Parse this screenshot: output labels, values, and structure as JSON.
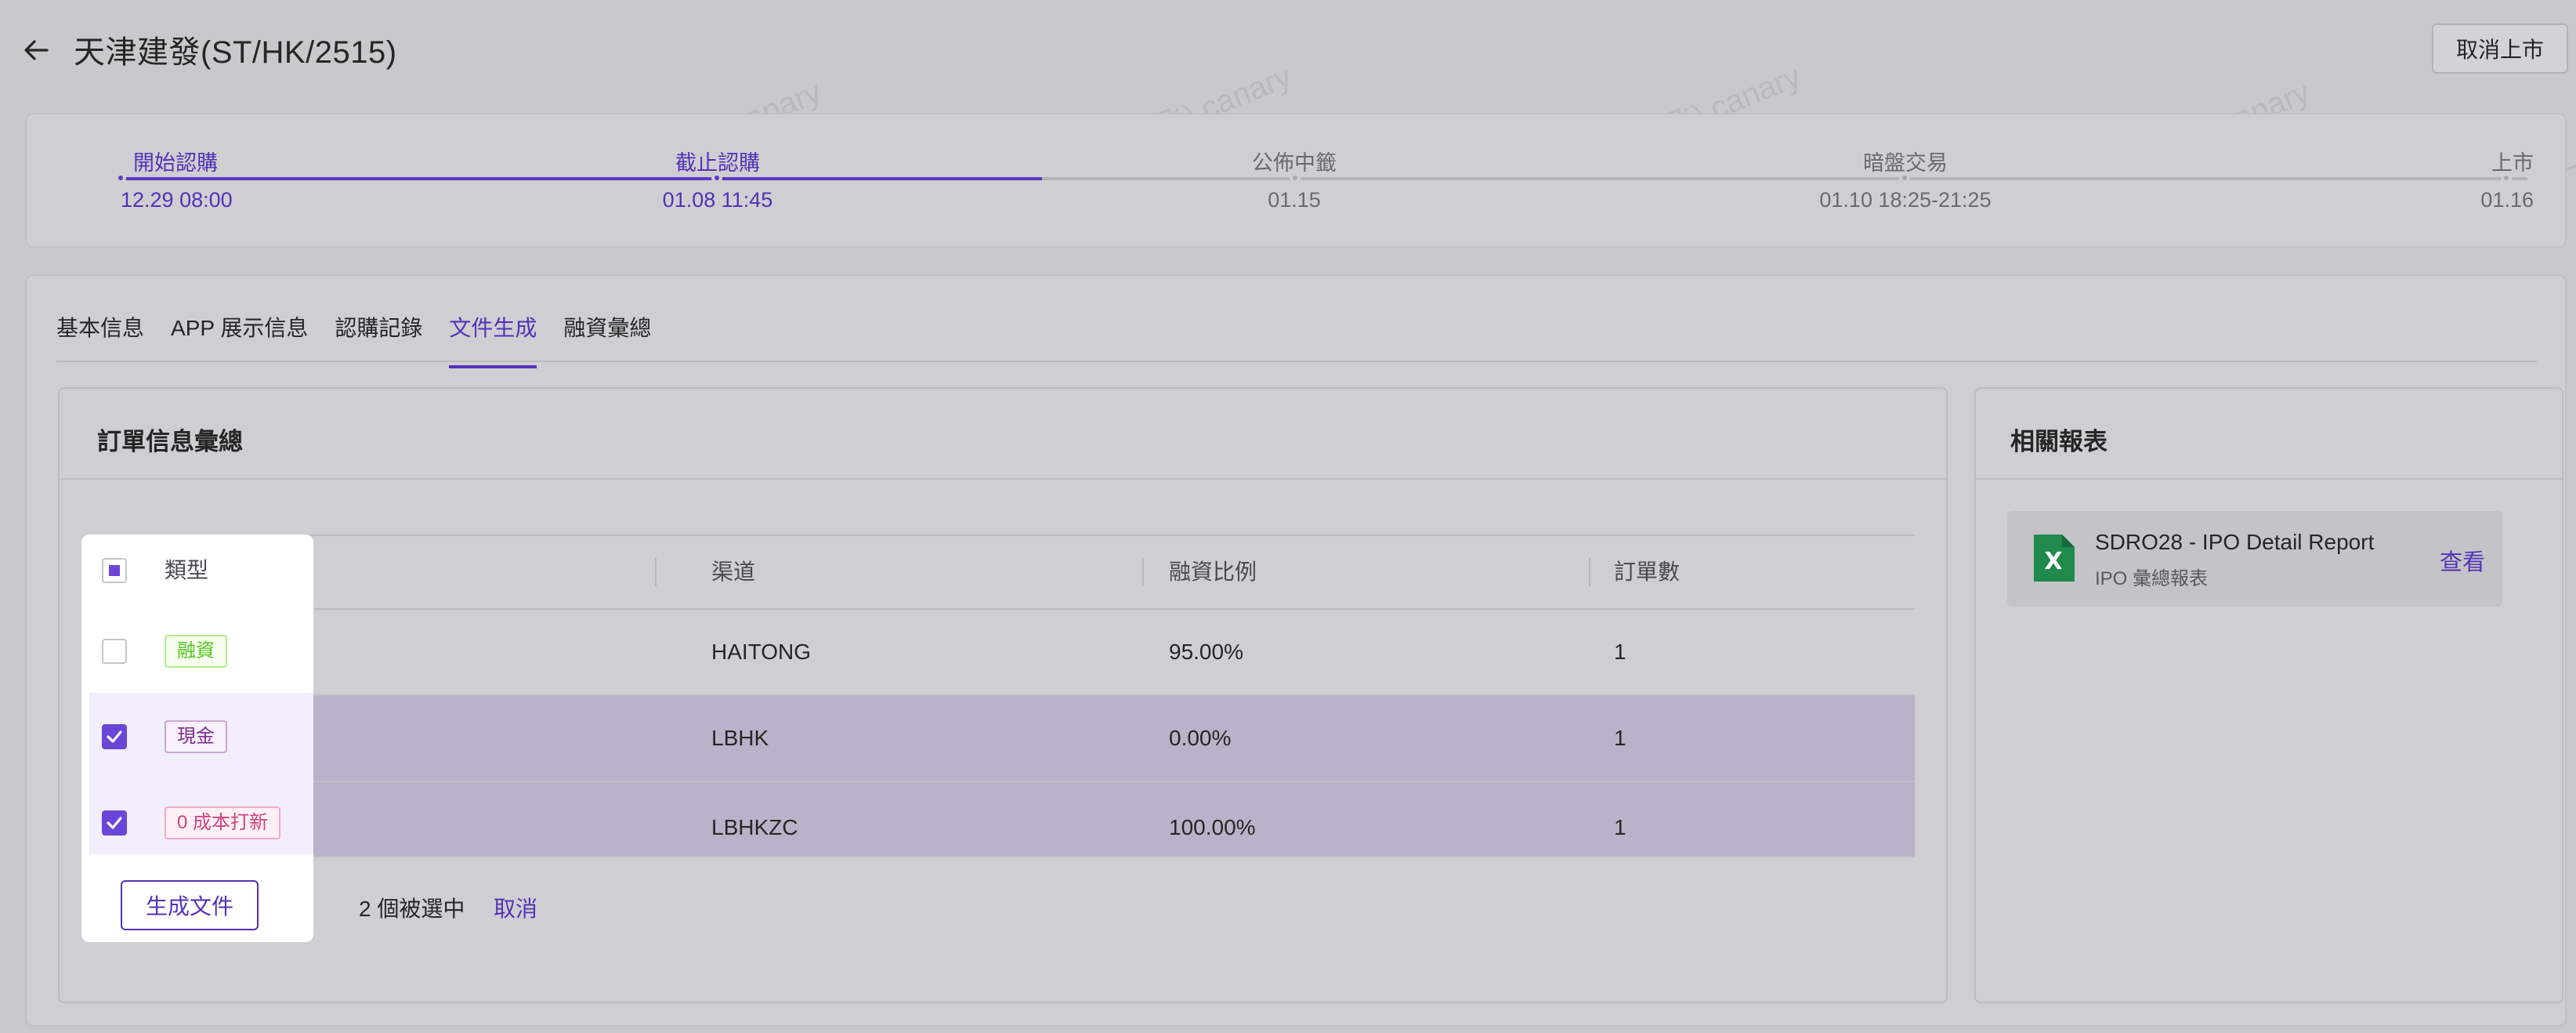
{
  "header": {
    "title": "天津建發(ST/HK/2515)",
    "unlist_label": "取消上市"
  },
  "timeline": [
    {
      "label": "開始認購",
      "time": "12.29 08:00",
      "status": "done"
    },
    {
      "label": "截止認購",
      "time": "01.08 11:45",
      "status": "done"
    },
    {
      "label": "公佈中籤",
      "time": "01.15",
      "status": "todo"
    },
    {
      "label": "暗盤交易",
      "time": "01.10 18:25-21:25",
      "status": "todo"
    },
    {
      "label": "上市",
      "time": "01.16",
      "status": "todo"
    }
  ],
  "tabs": [
    {
      "label": "基本信息",
      "active": false
    },
    {
      "label": "APP 展示信息",
      "active": false
    },
    {
      "label": "認購記錄",
      "active": false
    },
    {
      "label": "文件生成",
      "active": true
    },
    {
      "label": "融資彙總",
      "active": false
    }
  ],
  "orders": {
    "title": "訂單信息彙總",
    "columns": [
      "類型",
      "渠道",
      "融資比例",
      "訂單數"
    ],
    "rows": [
      {
        "type": "融資",
        "type_style": "finance",
        "channel": "HAITONG",
        "ratio": "95.00%",
        "count": "1",
        "checked": false
      },
      {
        "type": "現金",
        "type_style": "cash",
        "channel": "LBHK",
        "ratio": "0.00%",
        "count": "1",
        "checked": true
      },
      {
        "type": "0 成本打新",
        "type_style": "zero",
        "channel": "LBHKZC",
        "ratio": "100.00%",
        "count": "1",
        "checked": true
      }
    ],
    "generate_label": "生成文件",
    "selected_text": "2 個被選中",
    "cancel_label": "取消"
  },
  "reports": {
    "title": "相關報表",
    "items": [
      {
        "name": "SDRO28 - IPO Detail Report",
        "subtitle": "IPO 彙總報表",
        "action": "查看",
        "icon": "excel-icon"
      }
    ]
  },
  "colors": {
    "accent": "#5332b8",
    "checkbox_checked": "#6a46d8",
    "tag_finance": "#52c41a",
    "tag_cash": "#7a2d8c",
    "tag_zero": "#d1427e",
    "excel_green": "#1f8a4c"
  },
  "watermark": "夜天(赵宇飞) canary"
}
